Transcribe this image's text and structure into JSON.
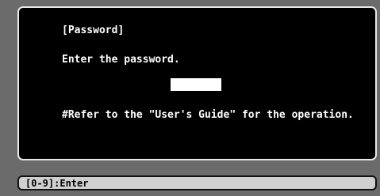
{
  "dialog": {
    "title": "[Password]",
    "prompt": "Enter the password.",
    "password_value": "",
    "note": "#Refer to the \"User's Guide\" for the operation."
  },
  "status_bar": {
    "text": "[0-9]:Enter"
  }
}
